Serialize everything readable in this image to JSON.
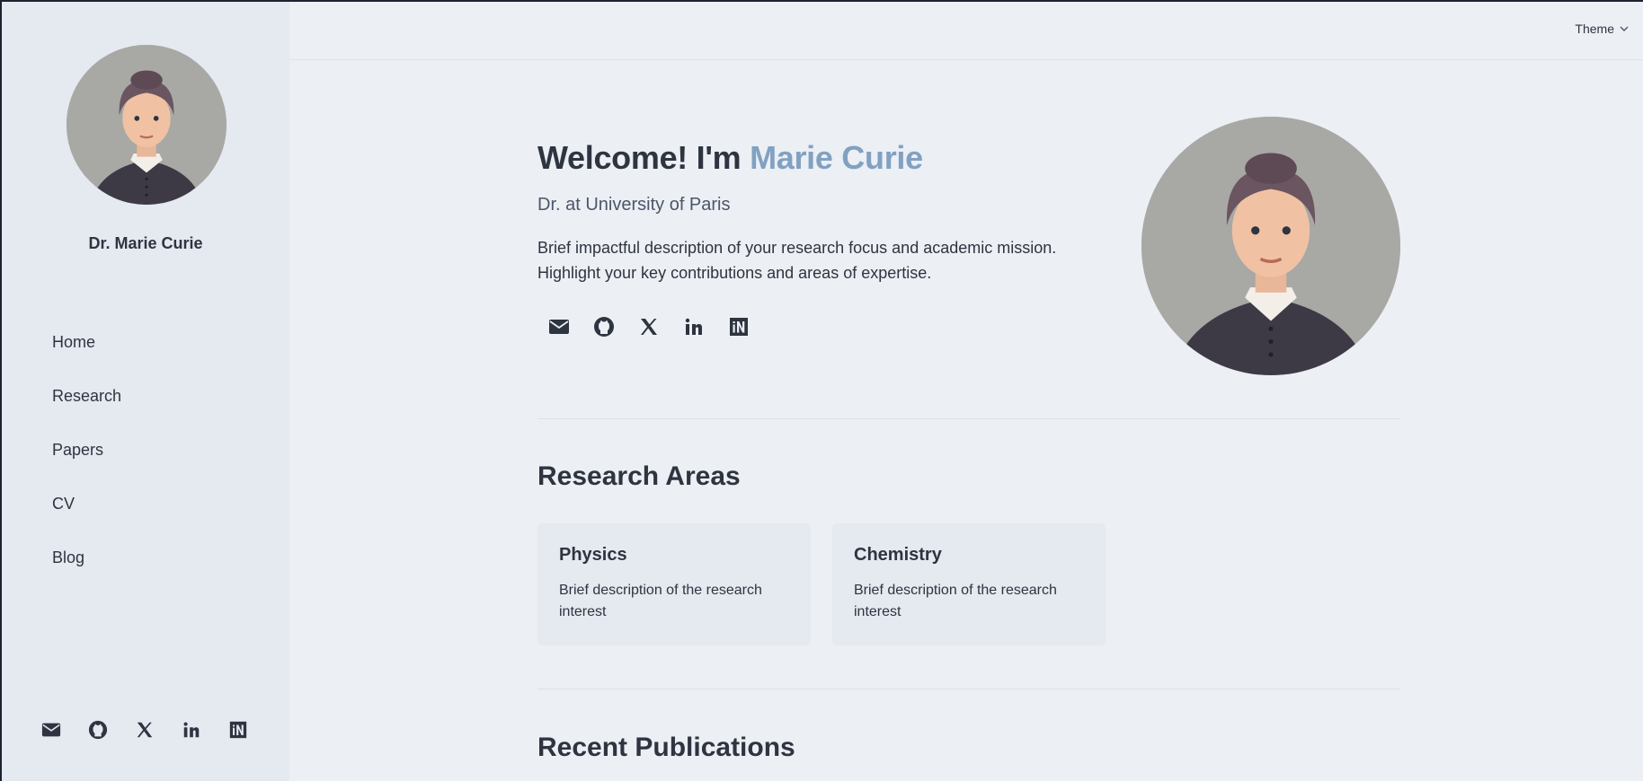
{
  "sidebar": {
    "name": "Dr. Marie Curie",
    "nav": [
      "Home",
      "Research",
      "Papers",
      "CV",
      "Blog"
    ],
    "social_icons": [
      "mail-icon",
      "github-icon",
      "x-icon",
      "linkedin-icon",
      "inspire-icon"
    ]
  },
  "topbar": {
    "theme_label": "Theme"
  },
  "hero": {
    "title_prefix": "Welcome! I'm ",
    "title_name": "Marie Curie",
    "subtitle": "Dr. at University of Paris",
    "description": "Brief impactful description of your research focus and academic mission. Highlight your key contributions and areas of expertise.",
    "social_icons": [
      "mail-icon",
      "github-icon",
      "x-icon",
      "linkedin-icon",
      "inspire-icon"
    ]
  },
  "research": {
    "title": "Research Areas",
    "cards": [
      {
        "title": "Physics",
        "description": "Brief description of the research interest"
      },
      {
        "title": "Chemistry",
        "description": "Brief description of the research interest"
      }
    ]
  },
  "publications": {
    "title": "Recent Publications"
  },
  "colors": {
    "accent": "#81a1c1",
    "text": "#2e3440",
    "background": "#eceff4",
    "sidebar": "#e5e9f0"
  }
}
